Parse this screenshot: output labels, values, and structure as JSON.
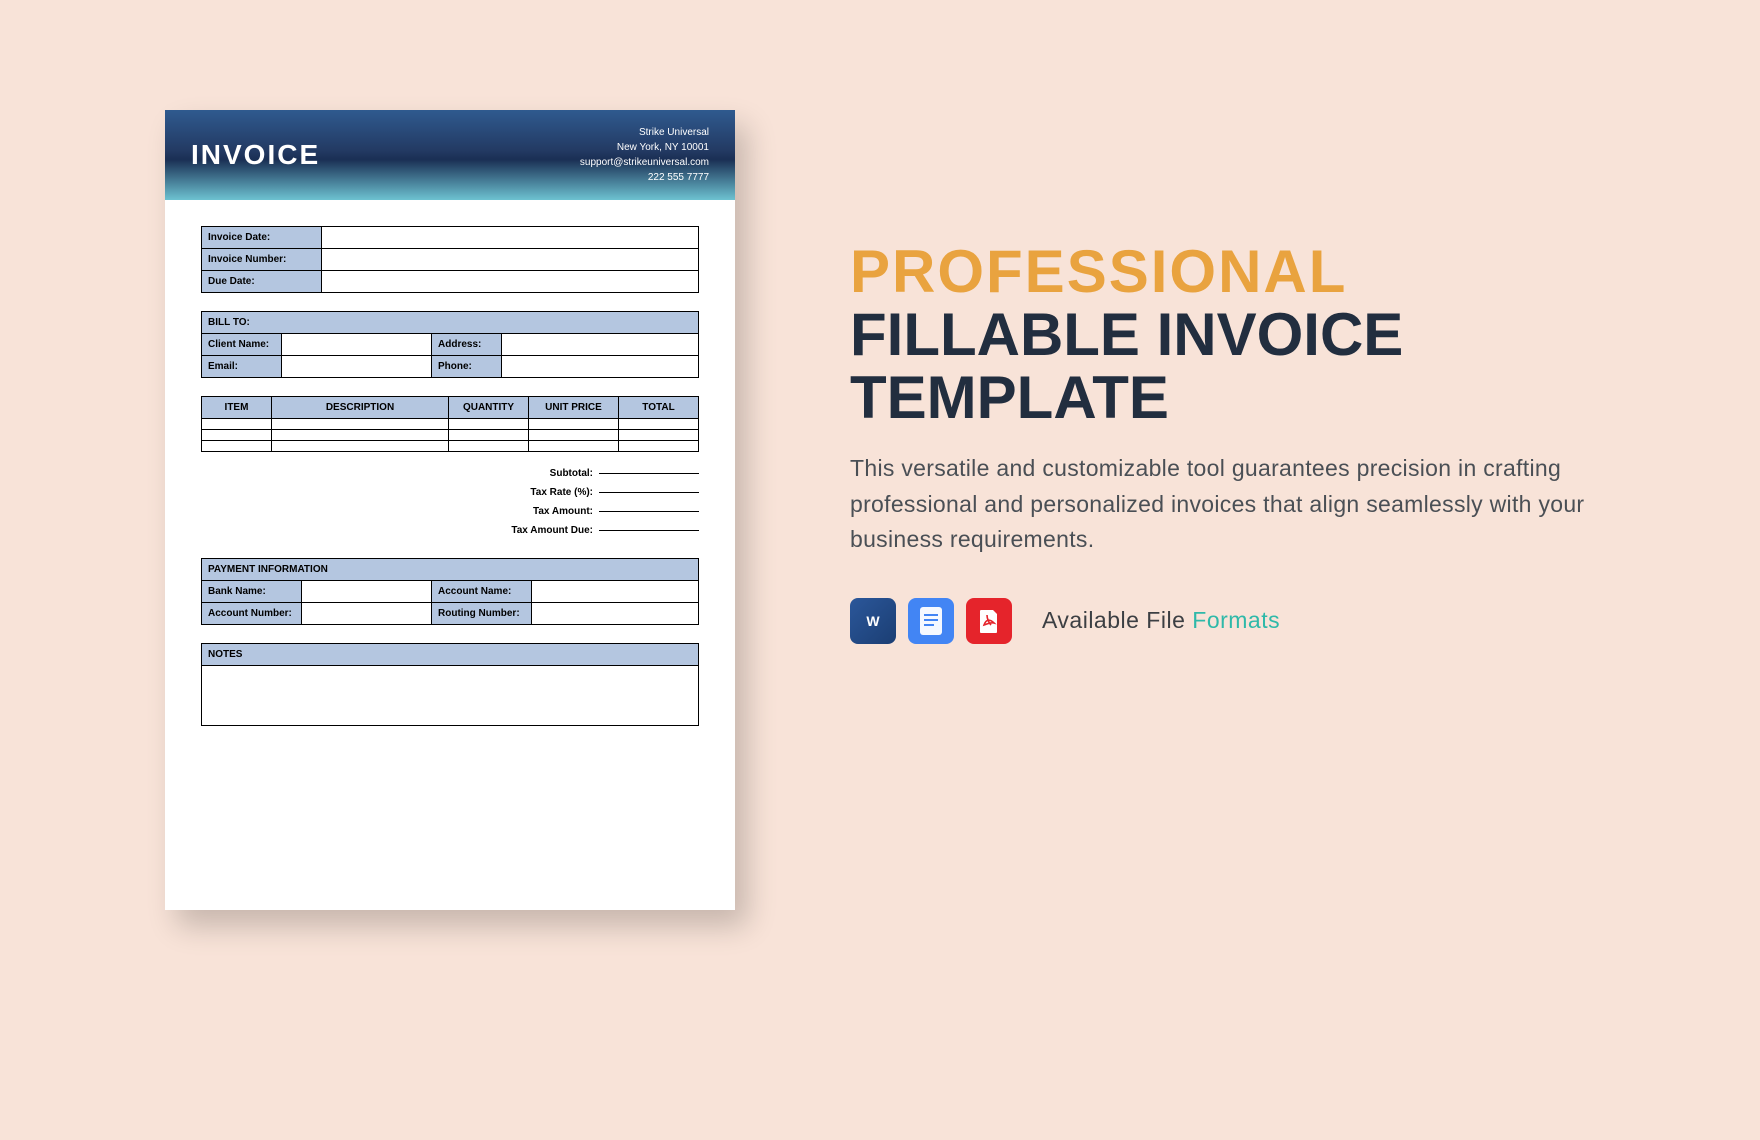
{
  "invoice": {
    "title": "INVOICE",
    "company": {
      "name": "Strike Universal",
      "address": "New York, NY 10001",
      "email": "support@strikeuniversal.com",
      "phone": "222 555 7777"
    },
    "meta_fields": {
      "invoice_date_label": "Invoice Date:",
      "invoice_number_label": "Invoice Number:",
      "due_date_label": "Due Date:"
    },
    "bill_to": {
      "header": "BILL TO:",
      "client_name_label": "Client Name:",
      "address_label": "Address:",
      "email_label": "Email:",
      "phone_label": "Phone:"
    },
    "items_table": {
      "item_header": "ITEM",
      "description_header": "DESCRIPTION",
      "quantity_header": "QUANTITY",
      "unit_price_header": "UNIT PRICE",
      "total_header": "TOTAL"
    },
    "totals": {
      "subtotal_label": "Subtotal:",
      "tax_rate_label": "Tax Rate (%):",
      "tax_amount_label": "Tax Amount:",
      "amount_due_label": "Tax Amount Due:"
    },
    "payment_info": {
      "header": "PAYMENT INFORMATION",
      "bank_name_label": "Bank Name:",
      "account_name_label": "Account Name:",
      "account_number_label": "Account Number:",
      "routing_number_label": "Routing Number:"
    },
    "notes_header": "NOTES"
  },
  "promo": {
    "title_accent": "PROFESSIONAL",
    "title_rest": "FILLABLE INVOICE TEMPLATE",
    "description": "This versatile and customizable tool guarantees precision in crafting professional and personalized invoices that align seamlessly with your business requirements.",
    "formats_label_a": "Available File ",
    "formats_label_b": "Formats",
    "icons": {
      "word": "W",
      "docs": "≡",
      "pdf": "PDF"
    }
  }
}
